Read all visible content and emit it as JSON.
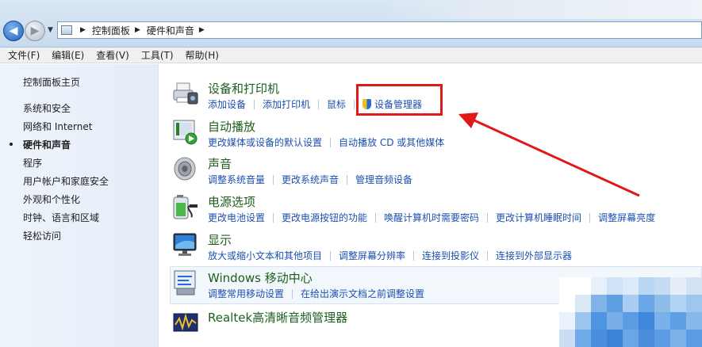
{
  "address": {
    "crumbs": [
      "控制面板",
      "硬件和声音"
    ]
  },
  "menu": [
    "文件(F)",
    "编辑(E)",
    "查看(V)",
    "工具(T)",
    "帮助(H)"
  ],
  "sidebar": {
    "items": [
      {
        "label": "控制面板主页",
        "active": false
      },
      {
        "label": "系统和安全",
        "active": false
      },
      {
        "label": "网络和 Internet",
        "active": false
      },
      {
        "label": "硬件和声音",
        "active": true
      },
      {
        "label": "程序",
        "active": false
      },
      {
        "label": "用户帐户和家庭安全",
        "active": false
      },
      {
        "label": "外观和个性化",
        "active": false
      },
      {
        "label": "时钟、语言和区域",
        "active": false
      },
      {
        "label": "轻松访问",
        "active": false
      }
    ]
  },
  "categories": [
    {
      "title": "设备和打印机",
      "icon": "printer-icon",
      "links": [
        "添加设备",
        "添加打印机",
        "鼠标",
        "设备管理器"
      ]
    },
    {
      "title": "自动播放",
      "icon": "autoplay-icon",
      "links": [
        "更改媒体或设备的默认设置",
        "自动播放 CD 或其他媒体"
      ]
    },
    {
      "title": "声音",
      "icon": "speaker-icon",
      "links": [
        "调整系统音量",
        "更改系统声音",
        "管理音频设备"
      ]
    },
    {
      "title": "电源选项",
      "icon": "battery-icon",
      "links": [
        "更改电池设置",
        "更改电源按钮的功能",
        "唤醒计算机时需要密码",
        "更改计算机睡眠时间",
        "调整屏幕亮度"
      ]
    },
    {
      "title": "显示",
      "icon": "monitor-icon",
      "links": [
        "放大或缩小文本和其他项目",
        "调整屏幕分辨率",
        "连接到投影仪",
        "连接到外部显示器"
      ]
    },
    {
      "title": "Windows 移动中心",
      "icon": "mobility-center-icon",
      "links": [
        "调整常用移动设置",
        "在给出演示文档之前调整设置"
      ]
    },
    {
      "title": "Realtek高清晰音频管理器",
      "icon": "realtek-audio-icon",
      "links": []
    }
  ],
  "colors": {
    "title_green": "#1e5e1e",
    "link_blue": "#1c50b0",
    "annotation_red": "#e01818"
  }
}
